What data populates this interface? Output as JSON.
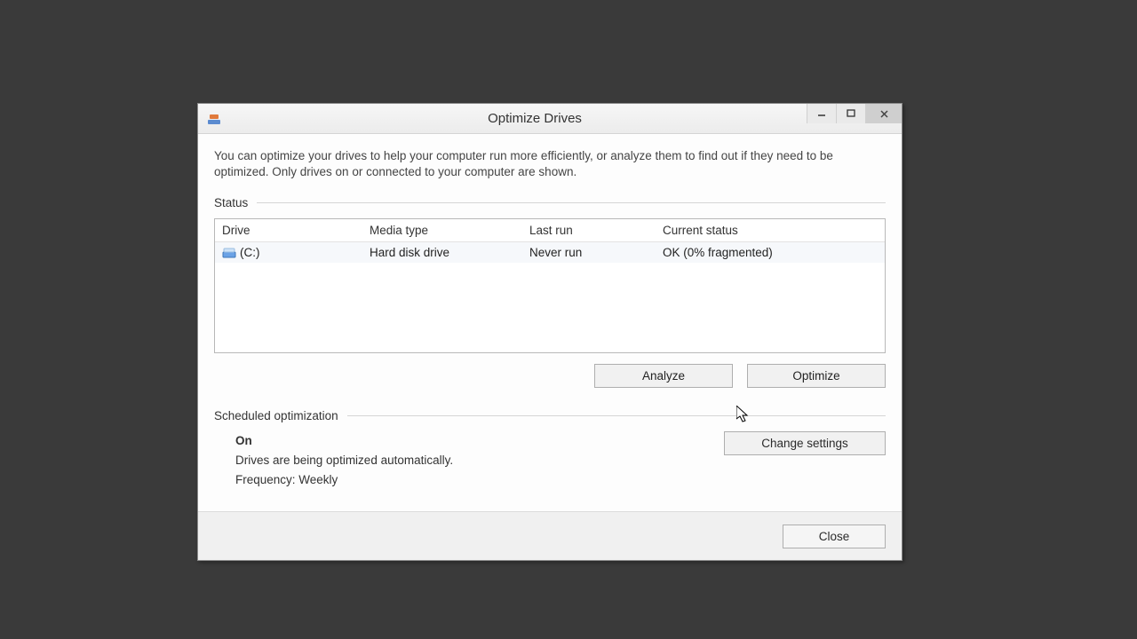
{
  "window": {
    "title": "Optimize Drives"
  },
  "description": "You can optimize your drives to help your computer run more efficiently, or analyze them to find out if they need to be optimized. Only drives on or connected to your computer are shown.",
  "status": {
    "heading": "Status",
    "columns": {
      "drive": "Drive",
      "media": "Media type",
      "last": "Last run",
      "current": "Current status"
    },
    "rows": [
      {
        "drive": "(C:)",
        "media": "Hard disk drive",
        "last": "Never run",
        "current": "OK (0% fragmented)"
      }
    ]
  },
  "buttons": {
    "analyze": "Analyze",
    "optimize": "Optimize",
    "change": "Change settings",
    "close": "Close"
  },
  "scheduled": {
    "heading": "Scheduled optimization",
    "state": "On",
    "desc": "Drives are being optimized automatically.",
    "freq": "Frequency: Weekly"
  }
}
